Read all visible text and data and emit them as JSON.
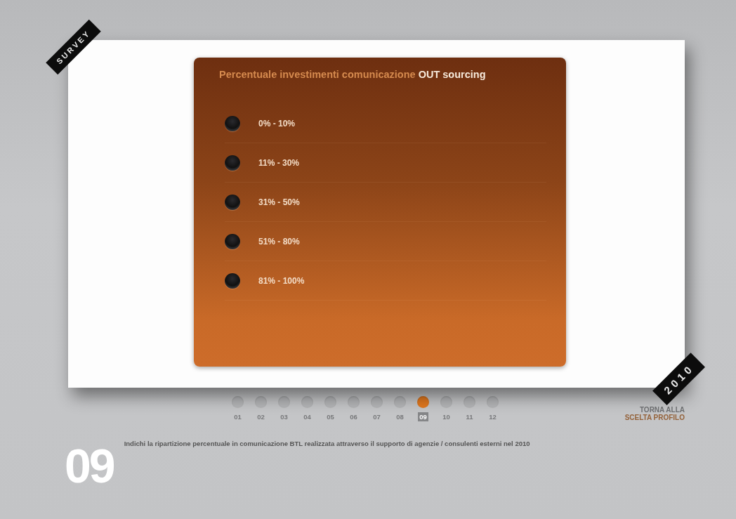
{
  "corner_tags": [
    "SURVEY",
    "2010"
  ],
  "question": {
    "title": "Percentuale investimenti comunicazione **OUT sourcing**",
    "options": [
      {
        "label": "0% - 10%",
        "selected": false
      },
      {
        "label": "11% - 30%",
        "selected": false
      },
      {
        "label": "31% - 50%",
        "selected": false
      },
      {
        "label": "51% - 80%",
        "selected": false
      },
      {
        "label": "81% - 100%",
        "selected": false
      }
    ]
  },
  "pager": [
    {
      "label": "01",
      "selected": false
    },
    {
      "label": "02",
      "selected": false
    },
    {
      "label": "03",
      "selected": false
    },
    {
      "label": "04",
      "selected": false
    },
    {
      "label": "05",
      "selected": false
    },
    {
      "label": "06",
      "selected": false
    },
    {
      "label": "07",
      "selected": false
    },
    {
      "label": "08",
      "selected": false
    },
    {
      "label": "09",
      "selected": true
    },
    {
      "label": "10",
      "selected": false
    },
    {
      "label": "11",
      "selected": false
    },
    {
      "label": "12",
      "selected": false
    }
  ],
  "back_link": [
    "TORNA ALLA",
    "SCELTA PROFILO"
  ],
  "footer": {
    "number": "09",
    "description": "Indichi la ripartizione percentuale in comunicazione BTL realizzata attraverso il supporto di agenzie / consulenti esterni nel 2010"
  }
}
